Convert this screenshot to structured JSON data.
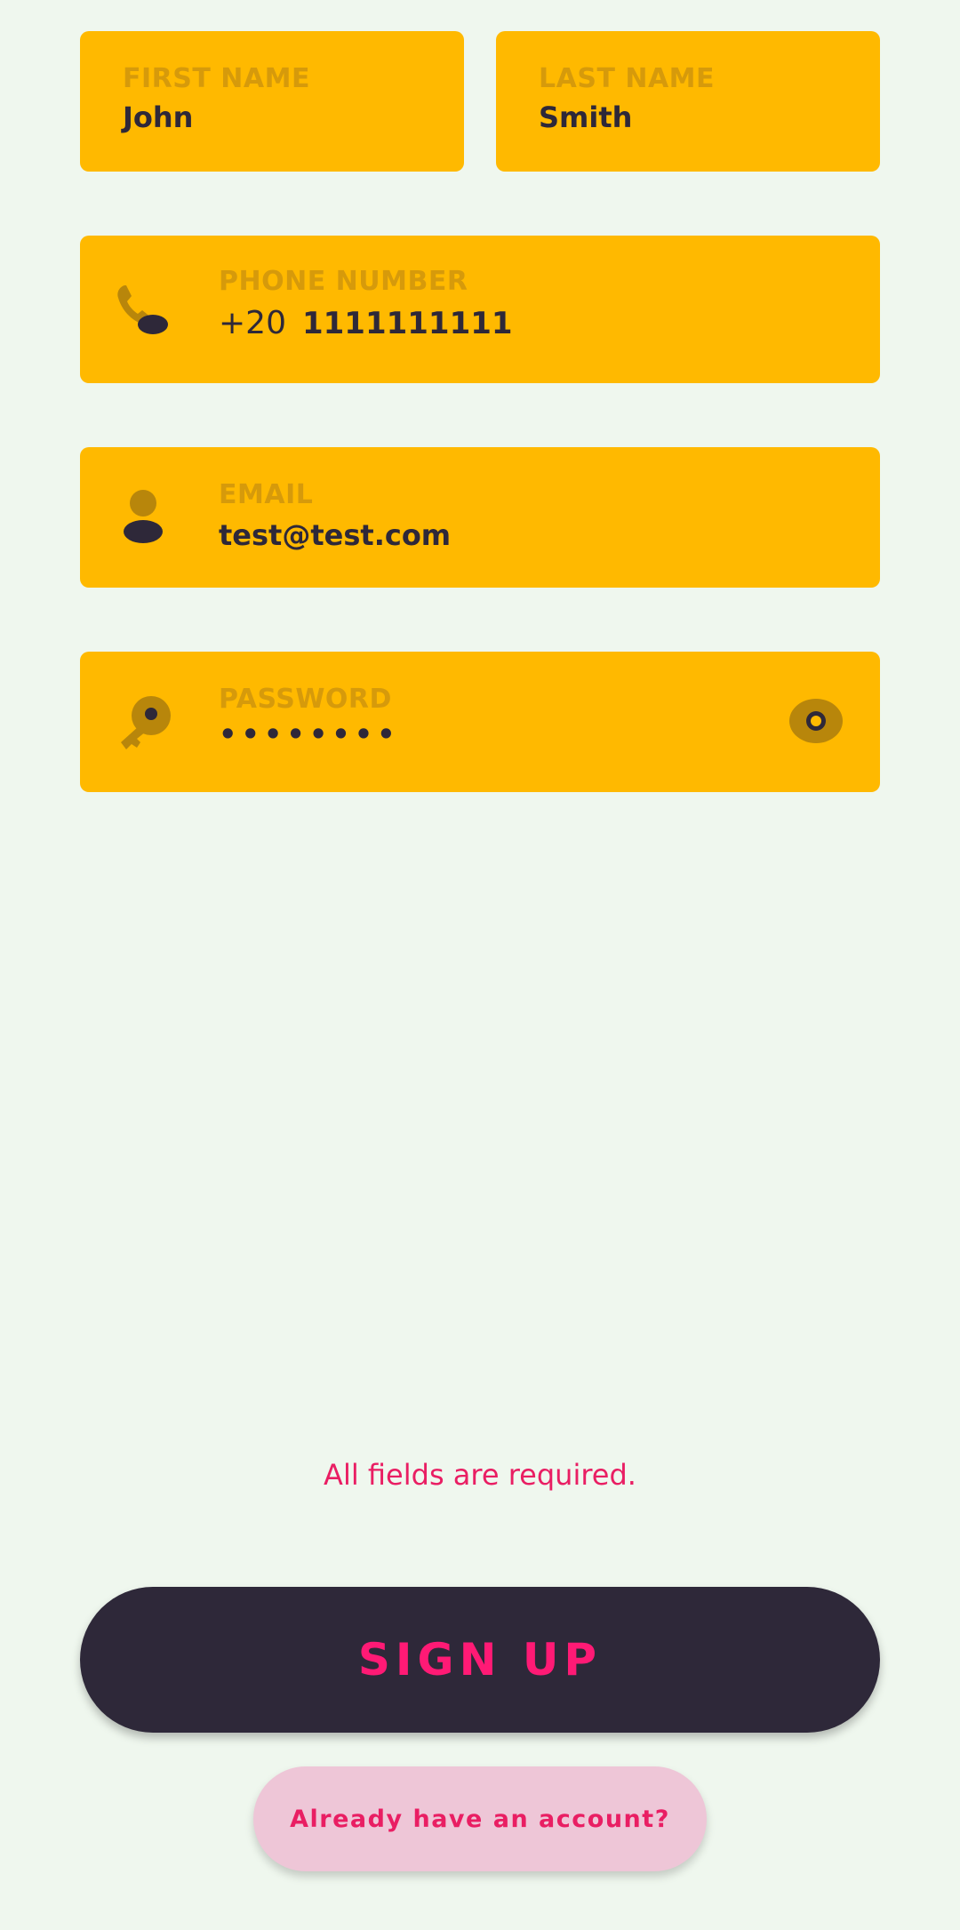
{
  "form": {
    "first_name": {
      "label": "FIRST NAME",
      "value": "John"
    },
    "last_name": {
      "label": "LAST NAME",
      "value": "Smith"
    },
    "phone": {
      "label": "PHONE NUMBER",
      "country_code": "+20",
      "value": "1111111111",
      "icon": "phone-icon"
    },
    "email": {
      "label": "EMAIL",
      "value": "test@test.com",
      "icon": "person-icon"
    },
    "password": {
      "label": "PASSWORD",
      "value": "••••••••",
      "icon": "key-icon",
      "toggle_icon": "eye-icon"
    }
  },
  "error_message": "All fields are required.",
  "signup_button": {
    "label": "SIGN UP"
  },
  "login_link": {
    "label": "Already have an account?"
  },
  "colors": {
    "background": "#EFF7EE",
    "field": "#FFB900",
    "label": "#D69A0B",
    "text": "#2E2839",
    "accent": "#E91E63",
    "icon": "#B8860B"
  }
}
